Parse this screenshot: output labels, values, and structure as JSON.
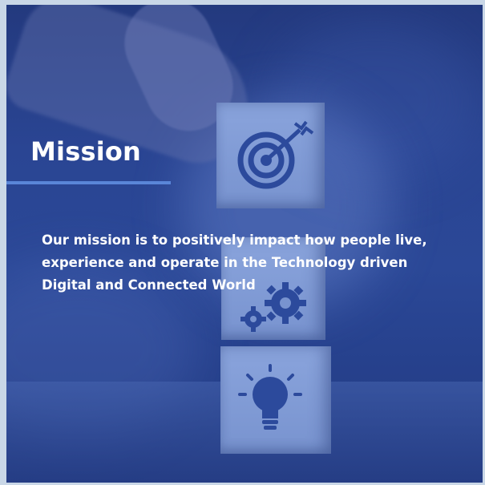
{
  "slide": {
    "title": "Mission",
    "body": "Our mission is to positively impact how people live, experience and operate in the Technology driven Digital and Connected World"
  },
  "colors": {
    "overlay": "#2b4897",
    "frame": "#c9d7e7",
    "accent_rule": "#5a86d8",
    "text": "#ffffff",
    "cube": "#8aa4dc",
    "icon": "#2c4a9c"
  },
  "icons": [
    "target-icon",
    "gears-icon",
    "lightbulb-icon"
  ]
}
